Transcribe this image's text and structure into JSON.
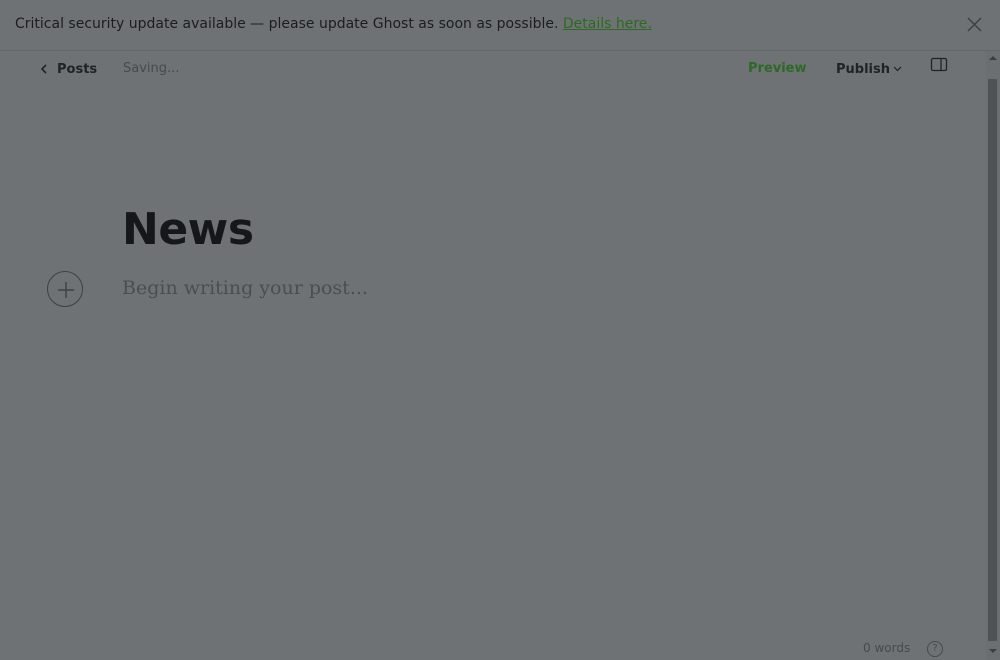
{
  "alert": {
    "message": "Critical security update available — please update Ghost as soon as possible.",
    "link_label": "Details here.",
    "close_icon": "close-icon"
  },
  "header": {
    "back_label": "Posts",
    "status": "Saving...",
    "preview_label": "Preview",
    "publish_label": "Publish",
    "sidebar_icon": "sidebar-toggle-icon"
  },
  "post": {
    "title": "News",
    "body_placeholder": "Begin writing your post..."
  },
  "footer": {
    "word_count": "0 words",
    "help_label": "?"
  },
  "colors": {
    "overlay": "#6f7275",
    "accent_green": "#2b6a24",
    "text_dark": "#15171a"
  }
}
